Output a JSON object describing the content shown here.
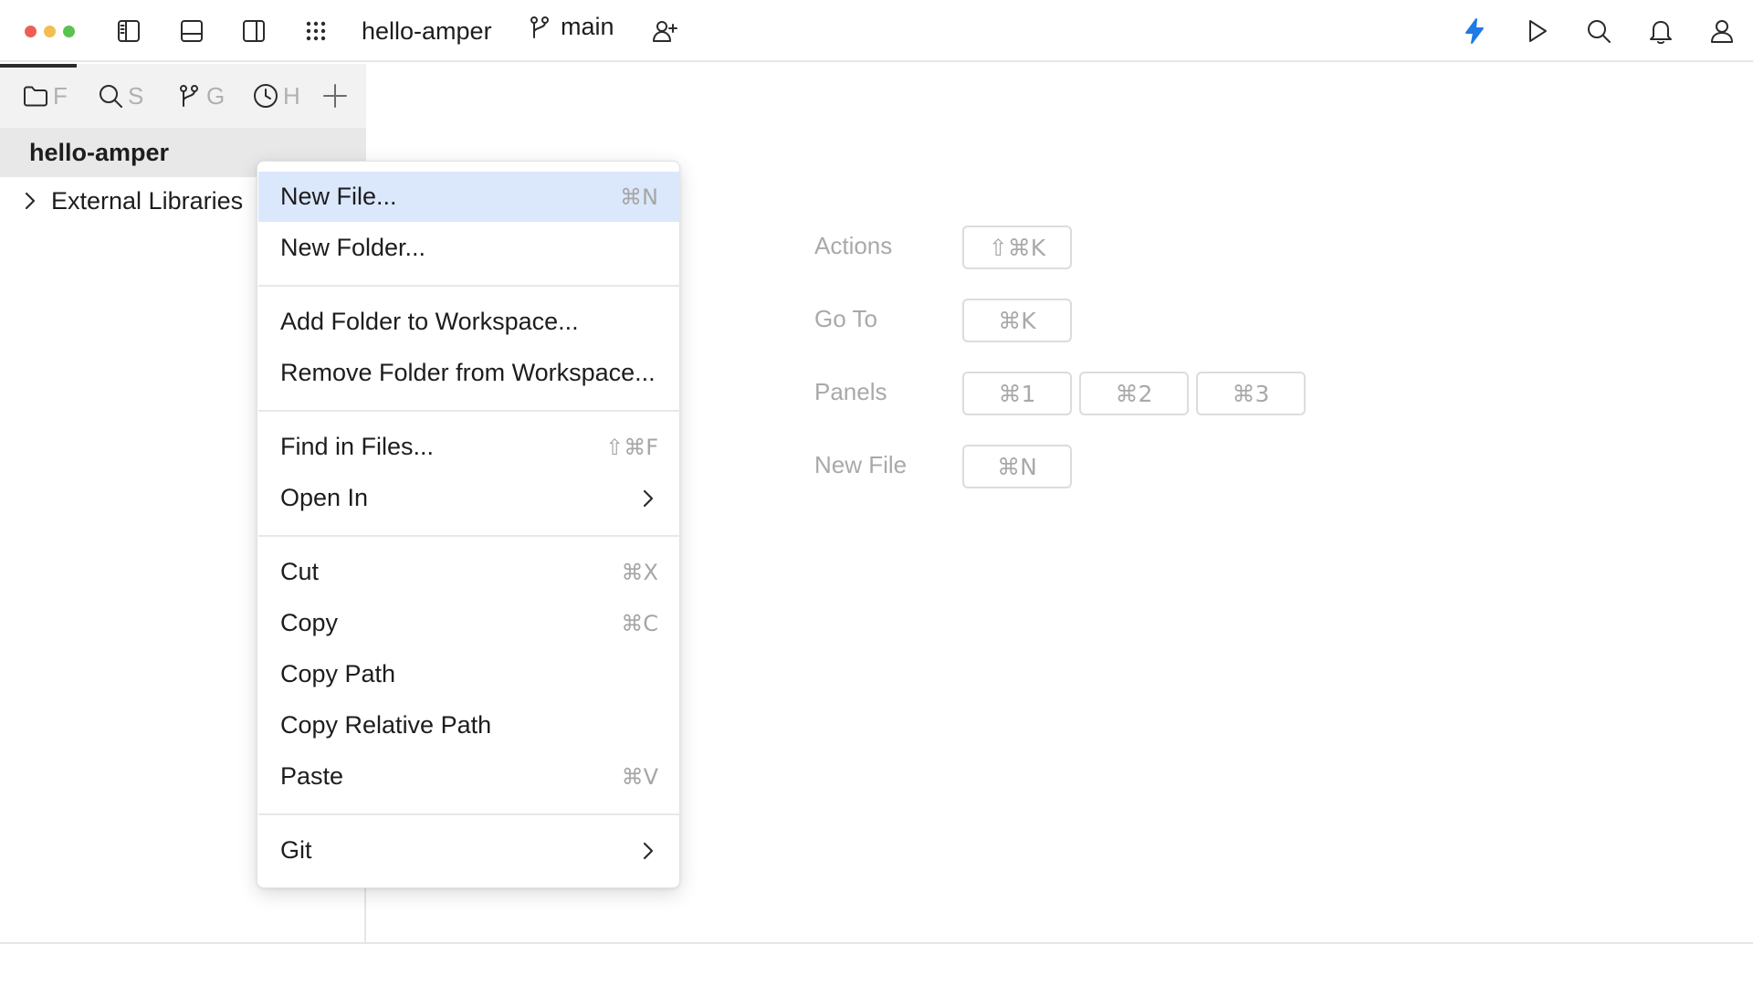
{
  "window": {
    "project_name": "hello-amper",
    "branch": "main",
    "colors": {
      "close": "#ec5f57",
      "minimize": "#f4bd4f",
      "zoom": "#5cc24f",
      "accent": "#1e7ae6",
      "menu_highlight": "#dbe8fb"
    },
    "toolbar_icons": [
      "sidebar-left-icon",
      "panel-bottom-icon",
      "sidebar-right-icon",
      "grid-dots-icon",
      "git-branch-icon",
      "add-user-icon",
      "bolt-icon",
      "play-icon",
      "search-icon",
      "bell-icon",
      "user-icon"
    ]
  },
  "sidebar": {
    "tabs": [
      {
        "icon": "folder-icon",
        "label": "F"
      },
      {
        "icon": "search-icon",
        "label": "S"
      },
      {
        "icon": "git-branch-icon",
        "label": "G"
      },
      {
        "icon": "clock-icon",
        "label": "H"
      },
      {
        "icon": "plus-icon",
        "label": ""
      }
    ],
    "project": "hello-amper",
    "tree": [
      {
        "label": "External Libraries",
        "expanded": false
      }
    ]
  },
  "context_menu": {
    "items": [
      {
        "label": "New File...",
        "shortcut": "⌘N",
        "highlighted": true
      },
      {
        "label": "New Folder...",
        "shortcut": ""
      },
      {
        "label": "Add Folder to Workspace...",
        "shortcut": ""
      },
      {
        "label": "Remove Folder from Workspace...",
        "shortcut": ""
      },
      {
        "label": "Find in Files...",
        "shortcut": "⇧⌘F"
      },
      {
        "label": "Open In",
        "shortcut": "",
        "submenu": true
      },
      {
        "label": "Cut",
        "shortcut": "⌘X"
      },
      {
        "label": "Copy",
        "shortcut": "⌘C"
      },
      {
        "label": "Copy Path",
        "shortcut": ""
      },
      {
        "label": "Copy Relative Path",
        "shortcut": ""
      },
      {
        "label": "Paste",
        "shortcut": "⌘V"
      },
      {
        "label": "Git",
        "shortcut": "",
        "submenu": true
      }
    ]
  },
  "shortcuts": {
    "actions": {
      "label": "Actions",
      "keys": [
        "⇧⌘K"
      ]
    },
    "goto": {
      "label": "Go To",
      "keys": [
        "⌘K"
      ]
    },
    "panels": {
      "label": "Panels",
      "keys": [
        "⌘1",
        "⌘2",
        "⌘3"
      ]
    },
    "new_file": {
      "label": "New File",
      "keys": [
        "⌘N"
      ]
    }
  }
}
